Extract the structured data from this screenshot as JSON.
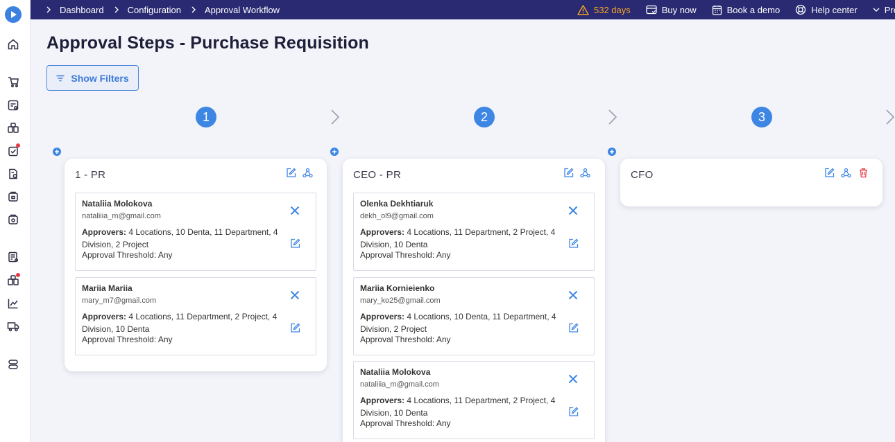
{
  "breadcrumb": [
    "Dashboard",
    "Configuration",
    "Approval Workflow"
  ],
  "topbar": {
    "trial": "532 days",
    "buy_now": "Buy now",
    "book_demo": "Book a demo",
    "help_center": "Help center",
    "profile_label": "Pre"
  },
  "sidebar": {
    "icons": [
      "logo-icon",
      "home-icon",
      "purchase-cart-icon",
      "requisition-icon",
      "orders-icon",
      "approvals-icon",
      "invoice-icon",
      "inventory-icon",
      "receiving-icon",
      "budget-icon",
      "suppliers-icon",
      "reports-icon",
      "delivery-icon",
      "settings-icon"
    ]
  },
  "page": {
    "title": "Approval Steps - Purchase Requisition",
    "filters_button": "Show Filters"
  },
  "steps": [
    "1",
    "2",
    "3"
  ],
  "approver_label": "Approvers:",
  "threshold_prefix": "Approval Threshold: ",
  "panels": [
    {
      "title": "1 - PR",
      "cards": [
        {
          "name": "Nataliia Molokova",
          "email": "nataliiia_m@gmail.com",
          "approvers": "4 Locations, 10 Denta, 11 Department, 4 Division, 2 Project",
          "threshold": "Any"
        },
        {
          "name": "Mariia Mariia",
          "email": "mary_m7@gmail.com",
          "approvers": "4 Locations, 11 Department, 2 Project, 4 Division, 10 Denta",
          "threshold": "Any"
        }
      ]
    },
    {
      "title": "CEO - PR",
      "cards": [
        {
          "name": "Olenka Dekhtiaruk",
          "email": "dekh_ol9@gmail.com",
          "approvers": "4 Locations, 11 Department, 2 Project, 4 Division, 10 Denta",
          "threshold": "Any"
        },
        {
          "name": "Mariia Kornieienko",
          "email": "mary_ko25@gmail.com",
          "approvers": "4 Locations, 10 Denta, 11 Department, 4 Division, 2 Project",
          "threshold": "Any"
        },
        {
          "name": "Nataliia Molokova",
          "email": "nataliiia_m@gmail.com",
          "approvers": "4 Locations, 11 Department, 2 Project, 4 Division, 10 Denta",
          "threshold": "Any"
        }
      ]
    },
    {
      "title": "CFO",
      "cards": []
    }
  ],
  "colors": {
    "accent": "#3d86e3",
    "topbar": "#2a2a72",
    "warning": "#f5a524",
    "danger": "#e53945"
  }
}
